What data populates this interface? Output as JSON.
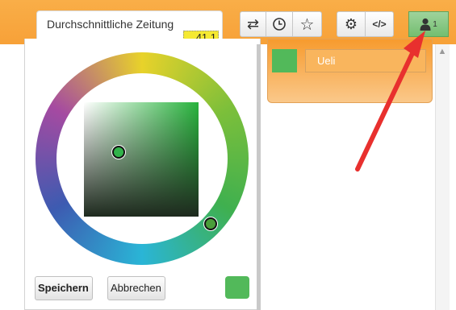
{
  "document": {
    "title": "Durchschnittliche Zeitung",
    "badge": "41.1"
  },
  "toolbar": {
    "buttons": [
      {
        "name": "swap-icon",
        "glyph": "⇄"
      },
      {
        "name": "history-icon",
        "glyph": "clock"
      },
      {
        "name": "star-icon",
        "glyph": "☆"
      },
      {
        "name": "gear-icon",
        "glyph": "⚙"
      },
      {
        "name": "code-icon",
        "glyph": "</>"
      }
    ],
    "users": {
      "icon": "user-icon",
      "count": "1"
    }
  },
  "users_panel": {
    "items": [
      {
        "name": "Ueli",
        "color": "#52b95a"
      }
    ]
  },
  "color_picker": {
    "selected_color": "#52b95a",
    "save_label": "Speichern",
    "cancel_label": "Abbrechen"
  },
  "annotation": {
    "arrow_color": "#e8302e"
  }
}
